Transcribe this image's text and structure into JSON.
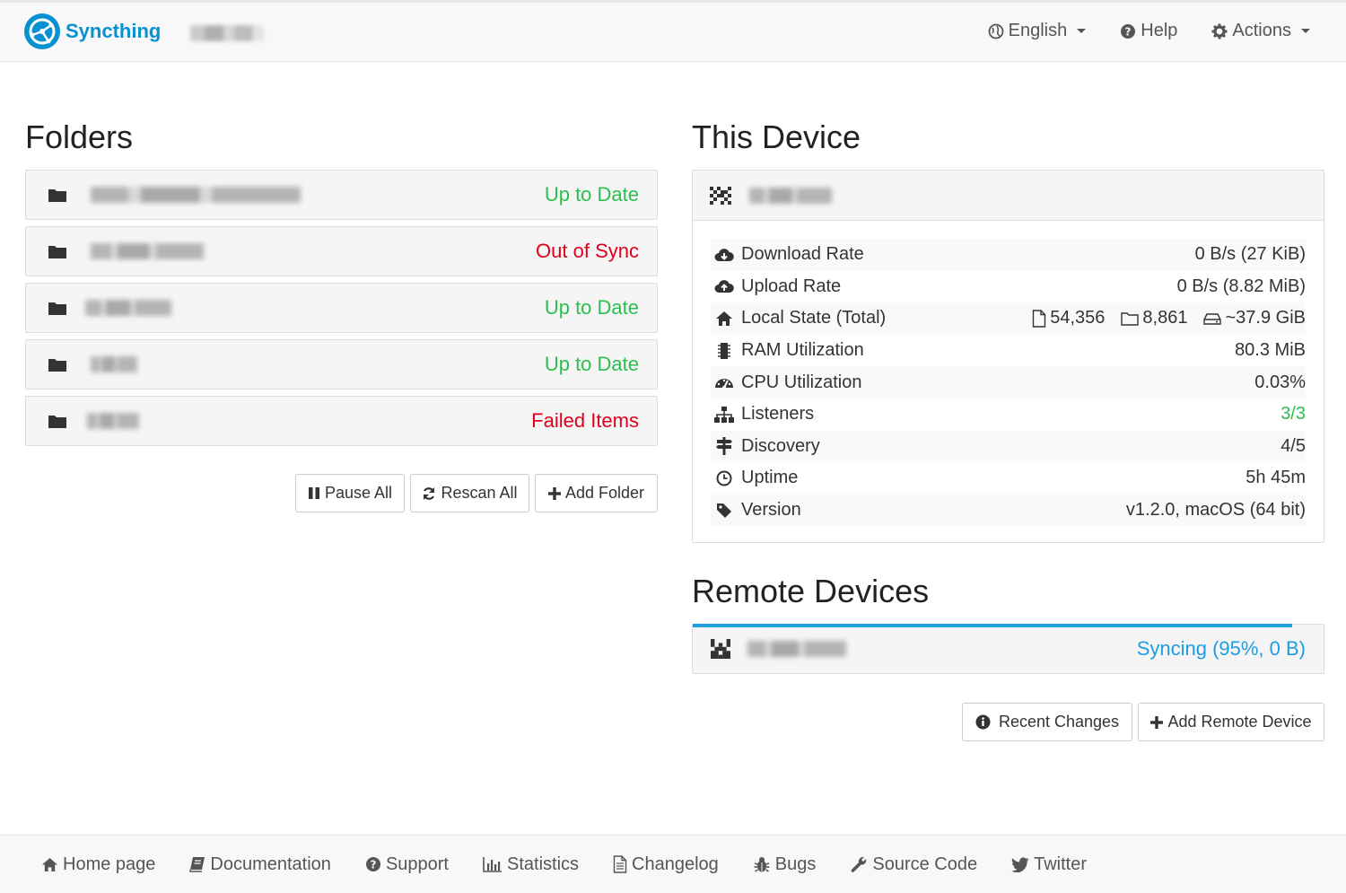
{
  "header": {
    "brand": "Syncthing",
    "nav": [
      {
        "label": "English",
        "icon": "globe-icon",
        "dropdown": true
      },
      {
        "label": "Help",
        "icon": "question-circle-icon",
        "dropdown": false
      },
      {
        "label": "Actions",
        "icon": "gear-icon",
        "dropdown": true
      }
    ]
  },
  "folders": {
    "title": "Folders",
    "items": [
      {
        "status": "Up to Date",
        "state": "ok"
      },
      {
        "status": "Out of Sync",
        "state": "bad"
      },
      {
        "status": "Up to Date",
        "state": "ok"
      },
      {
        "status": "Up to Date",
        "state": "ok"
      },
      {
        "status": "Failed Items",
        "state": "bad"
      }
    ],
    "buttons": {
      "pause": "Pause All",
      "rescan": "Rescan All",
      "add": "Add Folder"
    }
  },
  "this_device": {
    "title": "This Device",
    "stats": [
      {
        "label": "Download Rate",
        "value": "0 B/s (27 KiB)",
        "icon": "cloud-download-icon"
      },
      {
        "label": "Upload Rate",
        "value": "0 B/s (8.82 MiB)",
        "icon": "cloud-upload-icon"
      },
      {
        "label": "Local State (Total)",
        "icon": "home-icon",
        "files": "54,356",
        "dirs": "8,861",
        "size": "~37.9 GiB"
      },
      {
        "label": "RAM Utilization",
        "value": "80.3 MiB",
        "icon": "memory-icon"
      },
      {
        "label": "CPU Utilization",
        "value": "0.03%",
        "icon": "dashboard-icon"
      },
      {
        "label": "Listeners",
        "value": "3/3",
        "icon": "sitemap-icon",
        "accent": "#2cbe4e"
      },
      {
        "label": "Discovery",
        "value": "4/5",
        "icon": "signpost-icon"
      },
      {
        "label": "Uptime",
        "value": "5h 45m",
        "icon": "clock-icon"
      },
      {
        "label": "Version",
        "value": "v1.2.0, macOS (64 bit)",
        "icon": "tag-icon"
      }
    ]
  },
  "remote_devices": {
    "title": "Remote Devices",
    "items": [
      {
        "status": "Syncing (95%, 0 B)",
        "progress": 0.95
      }
    ],
    "buttons": {
      "recent": "Recent Changes",
      "add": "Add Remote Device"
    }
  },
  "footer": {
    "links": [
      {
        "label": "Home page",
        "icon": "home-icon"
      },
      {
        "label": "Documentation",
        "icon": "book-icon"
      },
      {
        "label": "Support",
        "icon": "question-circle-icon"
      },
      {
        "label": "Statistics",
        "icon": "bar-chart-icon"
      },
      {
        "label": "Changelog",
        "icon": "file-text-icon"
      },
      {
        "label": "Bugs",
        "icon": "bug-icon"
      },
      {
        "label": "Source Code",
        "icon": "wrench-icon"
      },
      {
        "label": "Twitter",
        "icon": "twitter-icon"
      }
    ]
  },
  "colors": {
    "brand": "#0891d1",
    "ok": "#2cbe4e",
    "bad": "#e0001b",
    "syncing": "#1e9de0"
  }
}
